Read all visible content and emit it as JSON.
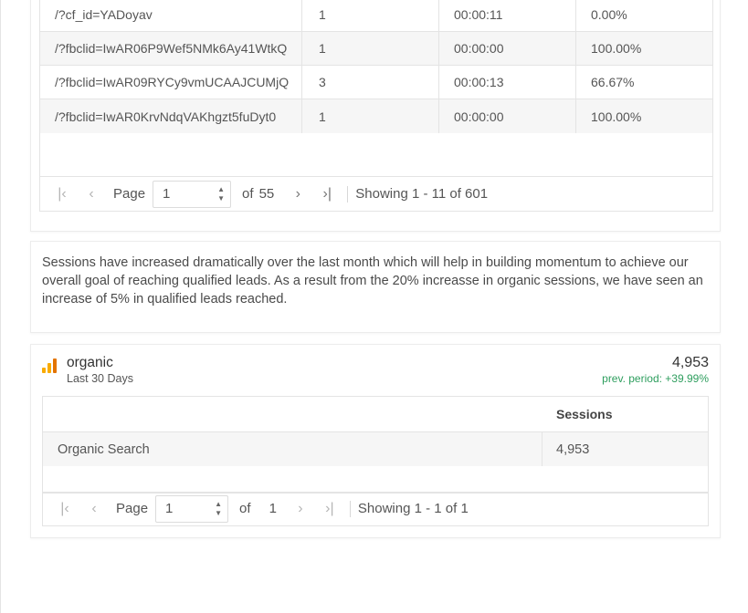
{
  "pages_table": {
    "rows": [
      {
        "page": "/?cf_id=YADoyav",
        "sessions": "1",
        "duration": "00:00:11",
        "rate": "0.00%"
      },
      {
        "page": "/?fbclid=IwAR06P9Wef5NMk6Ay41WtkQ",
        "sessions": "1",
        "duration": "00:00:00",
        "rate": "100.00%"
      },
      {
        "page": "/?fbclid=IwAR09RYCy9vmUCAAJCUMjQ",
        "sessions": "3",
        "duration": "00:00:13",
        "rate": "66.67%"
      },
      {
        "page": "/?fbclid=IwAR0KrvNdqVAKhgzt5fuDyt0",
        "sessions": "1",
        "duration": "00:00:00",
        "rate": "100.00%"
      }
    ],
    "pager": {
      "first_icon": "first-page-icon",
      "prev_icon": "prev-page-icon",
      "next_icon": "next-page-icon",
      "last_icon": "last-page-icon",
      "page_label": "Page",
      "page_value": "1",
      "of_label": "of",
      "total_pages": "55",
      "showing": "Showing 1 - 11 of 601"
    }
  },
  "note": {
    "text": "Sessions have increased dramatically over the last month which will help in building momentum to achieve our overall goal of reaching qualified leads. As a result from the 20% increasse in organic sessions, we have seen an increase of 5% in qualified leads reached."
  },
  "organic": {
    "icon": "google-analytics-icon",
    "title": "organic",
    "subtitle": "Last 30 Days",
    "value": "4,953",
    "prev_period": "prev. period: +39.99%",
    "table": {
      "header_sessions": "Sessions",
      "rows": [
        {
          "channel": "Organic Search",
          "sessions": "4,953"
        }
      ]
    },
    "pager": {
      "page_label": "Page",
      "page_value": "1",
      "of_label": "of",
      "total_pages": "1",
      "showing": "Showing 1 - 1 of 1"
    }
  },
  "colors": {
    "accent_positive": "#2e9e5e",
    "ga_orange": "#f9ab00",
    "ga_dark_orange": "#e37400"
  }
}
